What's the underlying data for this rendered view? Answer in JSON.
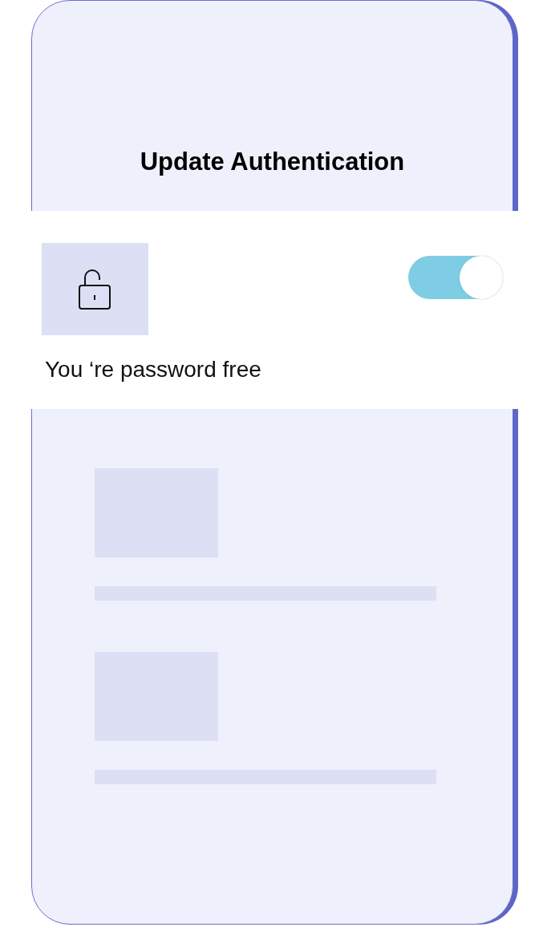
{
  "screen": {
    "title": "Update Authentication"
  },
  "auth_card": {
    "message": "You ‘re password free",
    "toggle": {
      "on": true
    }
  }
}
